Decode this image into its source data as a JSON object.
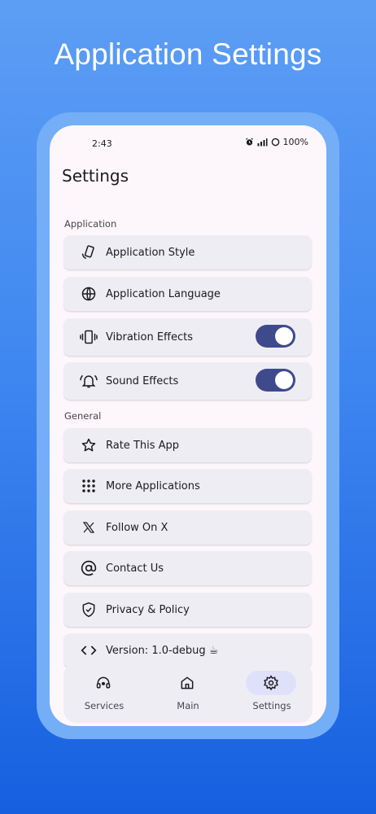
{
  "headline": "Application Settings",
  "status_bar": {
    "time": "2:43",
    "battery": "100%"
  },
  "page_title": "Settings",
  "sections": {
    "application": "Application",
    "general": "General"
  },
  "application_items": [
    {
      "label": "Application Style",
      "icon": "phone-rotate-icon"
    },
    {
      "label": "Application Language",
      "icon": "globe-icon"
    },
    {
      "label": "Vibration Effects",
      "icon": "vibration-icon",
      "toggle": true
    },
    {
      "label": "Sound Effects",
      "icon": "bell-ring-icon",
      "toggle": true
    }
  ],
  "general_items": [
    {
      "label": "Rate This App",
      "icon": "star-icon"
    },
    {
      "label": "More Applications",
      "icon": "apps-grid-icon"
    },
    {
      "label": "Follow On X",
      "icon": "x-logo-icon"
    },
    {
      "label": "Contact Us",
      "icon": "at-sign-icon"
    },
    {
      "label": "Privacy & Policy",
      "icon": "shield-check-icon"
    },
    {
      "label": "Version: 1.0-debug ☕",
      "icon": "code-icon"
    }
  ],
  "bottom_nav": [
    {
      "label": "Services",
      "icon": "support-agent-icon",
      "active": false
    },
    {
      "label": "Main",
      "icon": "home-icon",
      "active": false
    },
    {
      "label": "Settings",
      "icon": "gear-icon",
      "active": true
    }
  ],
  "colors": {
    "background_top": "#5d9ef5",
    "background_bottom": "#1660e0",
    "accent": "#3f4a8d",
    "row_background": "#efedf4",
    "active_nav_pill": "#dfe1fb"
  }
}
